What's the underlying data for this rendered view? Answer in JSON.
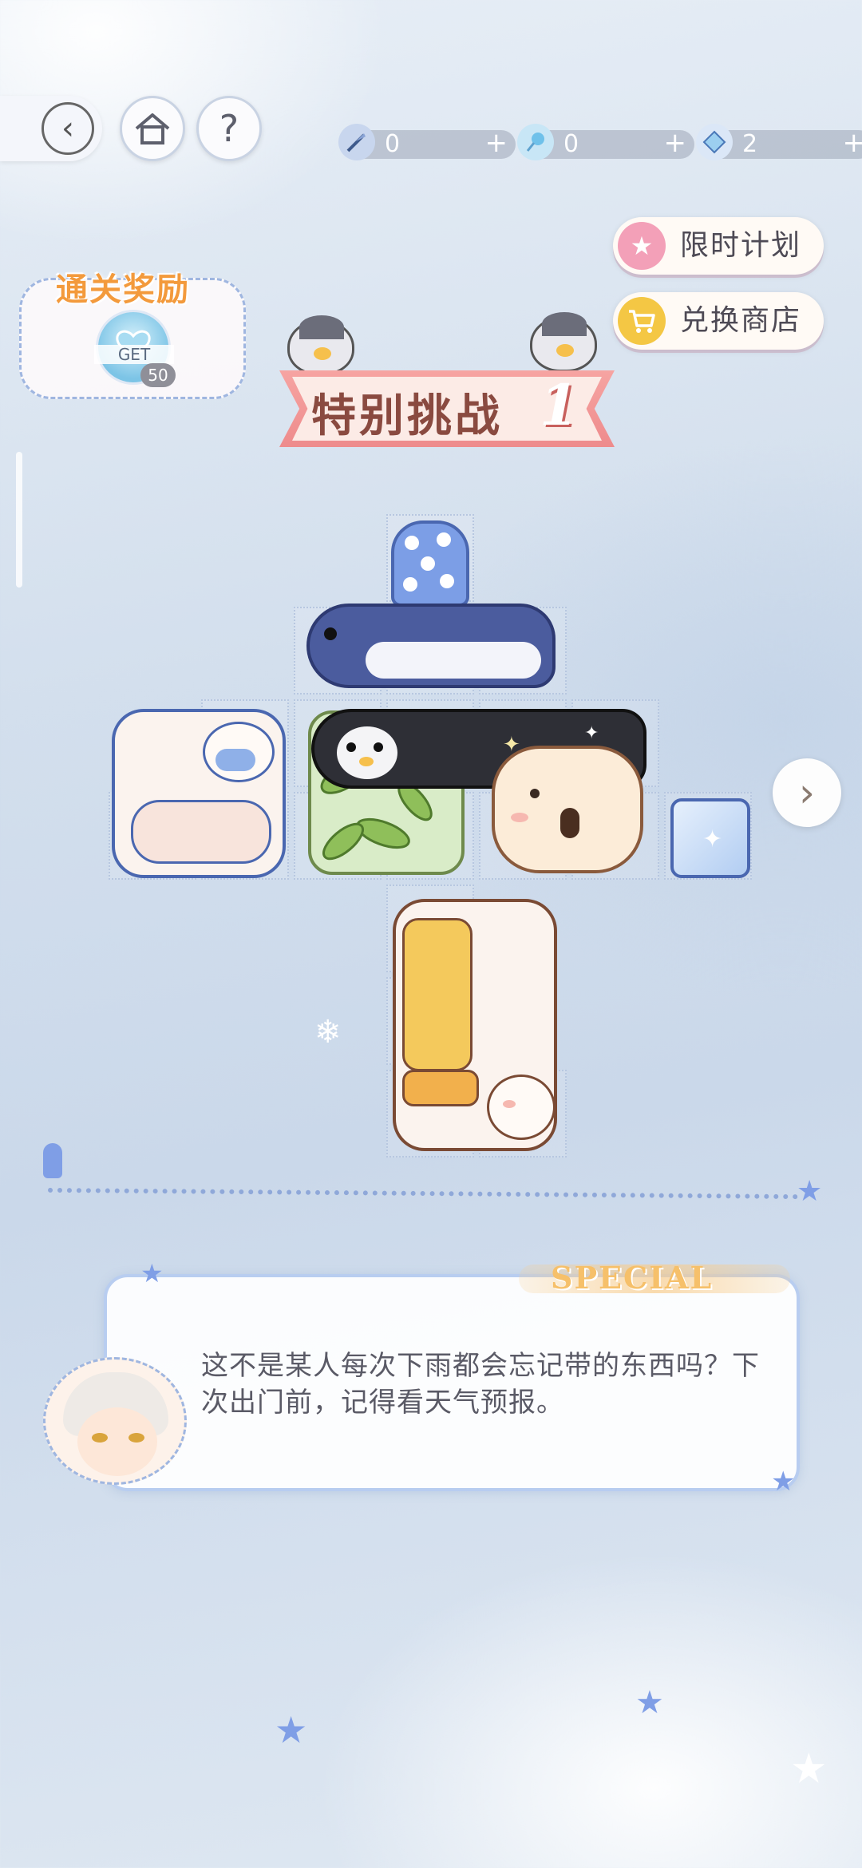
{
  "top_bar": {
    "back_icon": "back-arrow-icon",
    "home_icon": "home-icon",
    "help_label": "?",
    "resources": [
      {
        "icon": "feather-pen-icon",
        "value": "0",
        "plus": "+"
      },
      {
        "icon": "lollipop-icon",
        "value": "0",
        "plus": "+"
      },
      {
        "icon": "diamond-icon",
        "value": "2",
        "plus": "+"
      }
    ]
  },
  "side_buttons": {
    "limited_plan": "限时计划",
    "exchange_shop": "兑换商店"
  },
  "reward": {
    "title": "通关奖励",
    "get_label": "GET",
    "count": "50"
  },
  "banner": {
    "title": "特别挑战",
    "number": "1"
  },
  "dialog": {
    "special_label": "SPECIAL",
    "text": "这不是某人每次下雨都会忘记带的东西吗？下次出门前，记得看天气预报。"
  },
  "colors": {
    "accent_pink": "#ee8b8c",
    "accent_yellow": "#f6c04c",
    "dialog_border": "#b8cdf0",
    "background": "#d3dfed"
  }
}
